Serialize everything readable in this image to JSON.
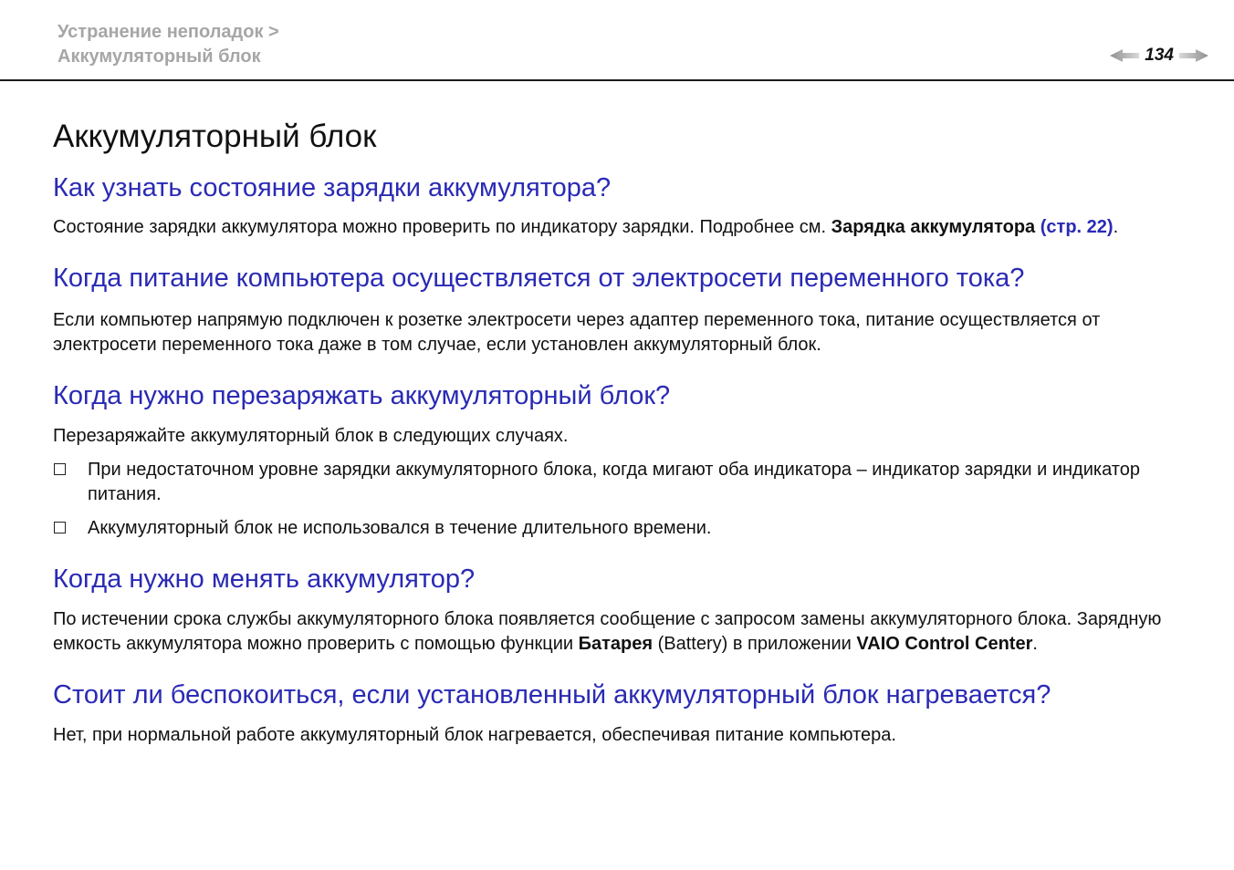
{
  "header": {
    "breadcrumb_line1": "Устранение неполадок >",
    "breadcrumb_line2": "Аккумуляторный блок",
    "page_number": "134",
    "icons": [
      "prev-page-arrow-icon",
      "next-page-arrow-icon"
    ]
  },
  "title": "Аккумуляторный блок",
  "sections": [
    {
      "heading": "Как узнать состояние зарядки аккумулятора?",
      "text": "Состояние зарядки аккумулятора можно проверить по индикатору зарядки. Подробнее см. ",
      "bold": "Зарядка аккумулятора",
      "link": "(стр. 22)",
      "end": "."
    },
    {
      "heading": "Когда питание компьютера осуществляется от электросети переменного тока?",
      "text": "Если компьютер напрямую подключен к розетке электросети через адаптер переменного тока, питание осуществляется от электросети переменного тока даже в том случае, если установлен аккумуляторный блок."
    },
    {
      "heading": "Когда нужно перезаряжать аккумуляторный блок?",
      "text": "Перезаряжайте аккумуляторный блок в следующих случаях.",
      "bullets": [
        "При недостаточном уровне зарядки аккумуляторного блока, когда мигают оба индикатора – индикатор зарядки и индикатор питания.",
        "Аккумуляторный блок не использовался в течение длительного времени."
      ]
    },
    {
      "heading": "Когда нужно менять аккумулятор?",
      "text": "По истечении срока службы аккумуляторного блока появляется сообщение с запросом замены аккумуляторного блока. Зарядную емкость аккумулятора можно проверить с помощью функции ",
      "bold1": "Батарея",
      "mid": " (Battery) в приложении ",
      "bold2": "VAIO Control Center",
      "end": "."
    },
    {
      "heading": "Стоит ли беспокоиться, если установленный аккумуляторный блок нагревается?",
      "text": "Нет, при нормальной работе аккумуляторный блок нагревается, обеспечивая питание компьютера."
    }
  ],
  "colors": {
    "heading": "#2a2ab5",
    "breadcrumb": "#a6a6a6",
    "text": "#111111"
  }
}
